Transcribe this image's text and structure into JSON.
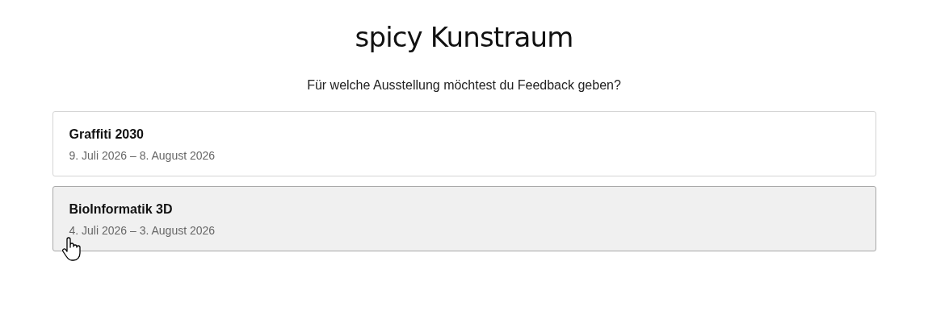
{
  "title": "spicy Kunstraum",
  "prompt": "Für welche Ausstellung möchtest du Feedback geben?",
  "exhibitions": [
    {
      "name": "Graffiti 2030",
      "dates": "9. Juli 2026 – 8. August 2026",
      "hovered": false
    },
    {
      "name": "BioInformatik 3D",
      "dates": "4. Juli 2026 – 3. August 2026",
      "hovered": true
    }
  ]
}
